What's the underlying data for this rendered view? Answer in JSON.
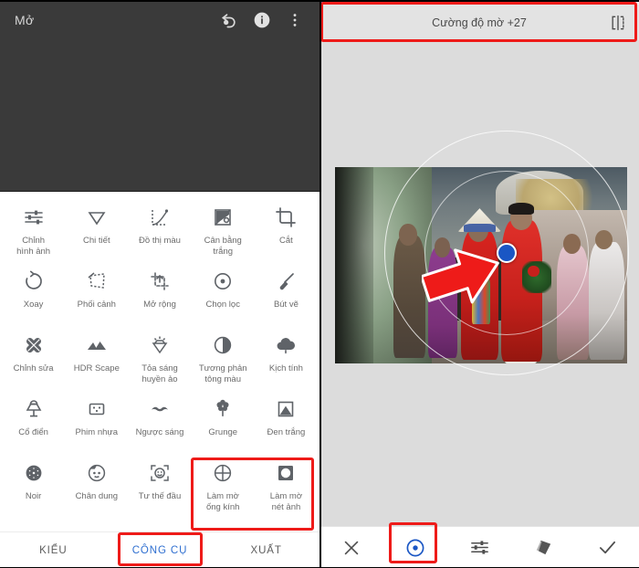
{
  "left": {
    "appbar": {
      "title": "Mở",
      "icons": [
        {
          "name": "undo-icon"
        },
        {
          "name": "info-icon"
        },
        {
          "name": "overflow-menu-icon"
        }
      ]
    },
    "tools": [
      [
        {
          "label": "Chỉnh\nhình ảnh",
          "icon": "tune-sliders-icon"
        },
        {
          "label": "Chi tiết",
          "icon": "triangle-down-icon"
        },
        {
          "label": "Đồ thị màu",
          "icon": "curves-graph-icon"
        },
        {
          "label": "Cân bằng\ntrắng",
          "icon": "white-balance-icon"
        },
        {
          "label": "Cắt",
          "icon": "crop-icon"
        }
      ],
      [
        {
          "label": "Xoay",
          "icon": "rotate-icon"
        },
        {
          "label": "Phối cảnh",
          "icon": "perspective-icon"
        },
        {
          "label": "Mở rộng",
          "icon": "expand-icon"
        },
        {
          "label": "Chọn lọc",
          "icon": "selective-target-icon"
        },
        {
          "label": "Bút vẽ",
          "icon": "brush-icon"
        }
      ],
      [
        {
          "label": "Chỉnh sửa",
          "icon": "healing-patch-icon"
        },
        {
          "label": "HDR Scape",
          "icon": "mountains-icon"
        },
        {
          "label": "Tỏa sáng\nhuyền ảo",
          "icon": "glamour-glow-icon"
        },
        {
          "label": "Tương phản\ntông màu",
          "icon": "tonal-contrast-icon"
        },
        {
          "label": "Kịch tính",
          "icon": "drama-cloud-icon"
        }
      ],
      [
        {
          "label": "Cổ điển",
          "icon": "vintage-lamp-icon"
        },
        {
          "label": "Phim nhựa",
          "icon": "grainy-film-icon"
        },
        {
          "label": "Ngược sáng",
          "icon": "retrolux-icon"
        },
        {
          "label": "Grunge",
          "icon": "grunge-icon"
        },
        {
          "label": "Đen trắng",
          "icon": "black-white-icon"
        }
      ],
      [
        {
          "label": "Noir",
          "icon": "noir-film-reel-icon"
        },
        {
          "label": "Chân dung",
          "icon": "portrait-face-icon"
        },
        {
          "label": "Tư thế đầu",
          "icon": "head-pose-icon"
        },
        {
          "label": "Làm mờ\nống kính",
          "icon": "lens-blur-icon"
        },
        {
          "label": "Làm mờ\nnét ảnh",
          "icon": "vignette-blur-icon"
        }
      ]
    ],
    "tabs": [
      {
        "label": "KIỂU",
        "active": false
      },
      {
        "label": "CÔNG CỤ",
        "active": true
      },
      {
        "label": "XUẤT",
        "active": false
      }
    ]
  },
  "right": {
    "progress_percent": 27,
    "header": {
      "parameter_text": "Cường độ mờ +27",
      "compare_icon": "compare-split-icon"
    },
    "photo": {
      "description": "Vietnamese wedding procession, bride and groom in red áo dài",
      "focus_dot_color": "#1a56c4"
    },
    "annotation": {
      "arrow_color": "#ee1b19",
      "box_color": "#ee1b19"
    },
    "bottom_bar": [
      {
        "name": "cancel-button",
        "icon": "close-x-icon",
        "accent": false
      },
      {
        "name": "lens-blur-button",
        "icon": "focus-target-icon",
        "accent": true
      },
      {
        "name": "adjust-button",
        "icon": "tune-sliders-icon",
        "accent": false
      },
      {
        "name": "stack-button",
        "icon": "layers-stack-icon",
        "accent": false
      },
      {
        "name": "confirm-button",
        "icon": "check-icon",
        "accent": false
      }
    ]
  }
}
